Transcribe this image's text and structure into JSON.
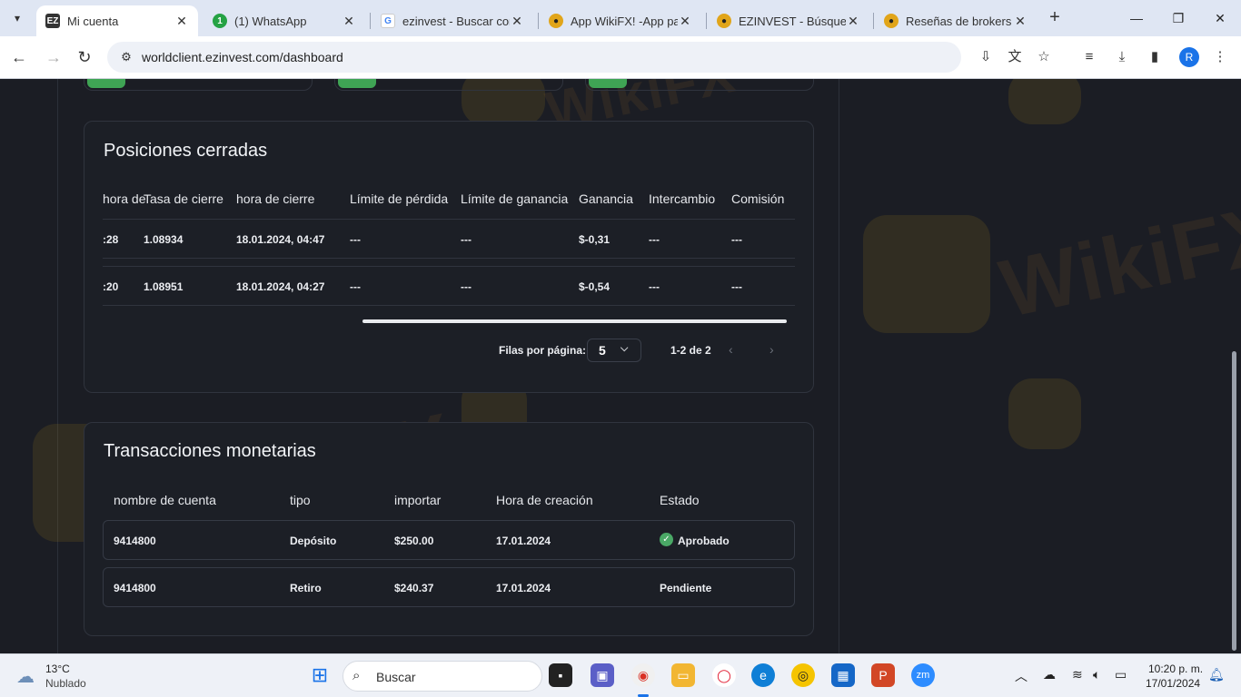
{
  "browser": {
    "tabs": [
      {
        "title": "Mi cuenta",
        "active": true,
        "favicon": "ezinvest-logo"
      },
      {
        "title": "(1) WhatsApp",
        "active": false,
        "favicon": "whatsapp-logo"
      },
      {
        "title": "ezinvest - Buscar con",
        "active": false,
        "favicon": "google-logo"
      },
      {
        "title": "App WikiFX! -App pa",
        "active": false,
        "favicon": "wikifx-logo"
      },
      {
        "title": "EZINVEST - Búsqueda",
        "active": false,
        "favicon": "wikifx-logo"
      },
      {
        "title": "Reseñas de brokers d",
        "active": false,
        "favicon": "wikifx-logo"
      }
    ],
    "url": "worldclient.ezinvest.com/dashboard",
    "profile_initial": "R"
  },
  "closed_positions": {
    "title": "Posiciones cerradas",
    "columns": [
      "hora de",
      "Tasa de cierre",
      "hora de cierre",
      "Límite de pérdida",
      "Límite de ganancia",
      "Ganancia",
      "Intercambio",
      "Comisión"
    ],
    "rows": [
      {
        "open_time": ":28",
        "close_rate": "1.08934",
        "close_time": "18.01.2024, 04:47",
        "stop_loss": "---",
        "take_profit": "---",
        "profit": "$-0,31",
        "swap": "---",
        "commission": "---"
      },
      {
        "open_time": ":20",
        "close_rate": "1.08951",
        "close_time": "18.01.2024, 04:27",
        "stop_loss": "---",
        "take_profit": "---",
        "profit": "$-0,54",
        "swap": "---",
        "commission": "---"
      }
    ],
    "pagination": {
      "rows_per_page_label": "Filas por página:",
      "rows_per_page": "5",
      "range": "1-2 de 2"
    }
  },
  "transactions": {
    "title": "Transacciones monetarias",
    "columns": [
      "nombre de cuenta",
      "tipo",
      "importar",
      "Hora de creación",
      "Estado"
    ],
    "rows": [
      {
        "account": "9414800",
        "type": "Depósito",
        "amount": "$250.00",
        "created": "17.01.2024",
        "status": "Aprobado",
        "status_icon": "check-circle-icon"
      },
      {
        "account": "9414800",
        "type": "Retiro",
        "amount": "$240.37",
        "created": "17.01.2024",
        "status": "Pendiente",
        "status_icon": ""
      }
    ]
  },
  "watermark": "WikiFX",
  "taskbar": {
    "weather_temp": "13°C",
    "weather_desc": "Nublado",
    "search_placeholder": "Buscar",
    "time": "10:20 p. m.",
    "date": "17/01/2024"
  },
  "colors": {
    "page_bg": "#1b1d24",
    "card_border": "#30343e",
    "success": "#4aa866",
    "topcard_chip": "#3fa454"
  }
}
